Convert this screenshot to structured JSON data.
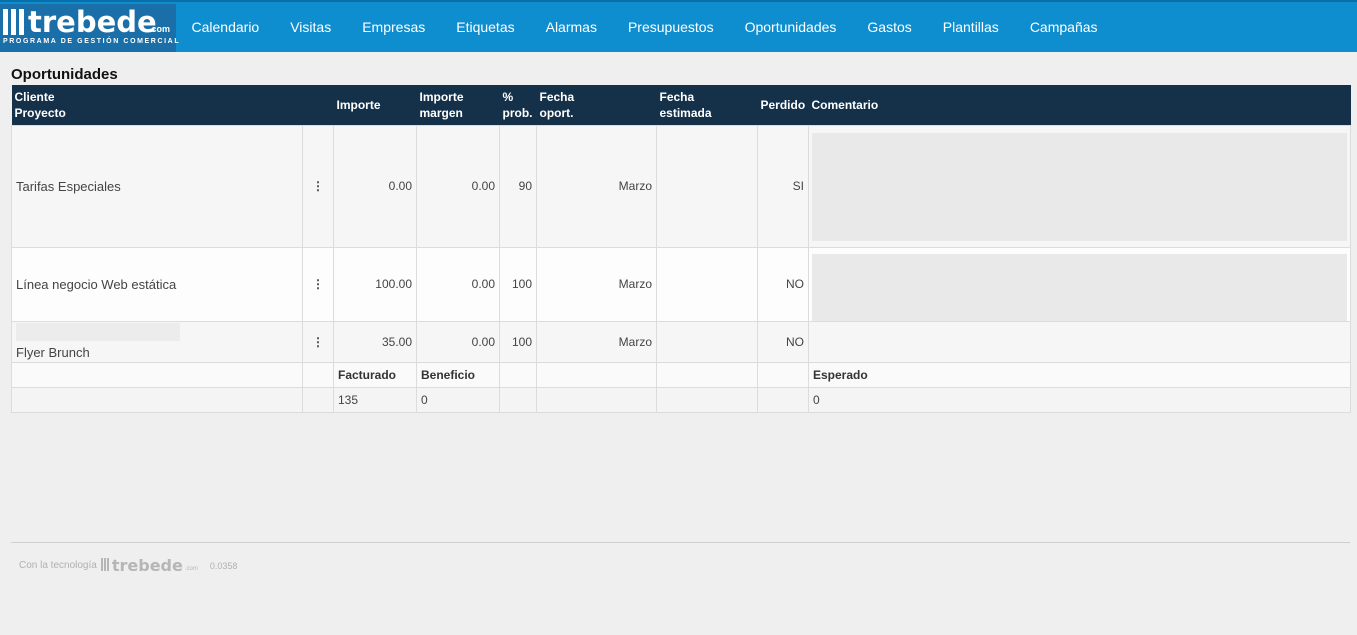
{
  "brand": {
    "name": "trebede",
    "suffix": ".com",
    "tagline": "PROGRAMA DE GESTIÓN COMERCIAL"
  },
  "nav": [
    {
      "label": "Calendario"
    },
    {
      "label": "Visitas"
    },
    {
      "label": "Empresas"
    },
    {
      "label": "Etiquetas"
    },
    {
      "label": "Alarmas"
    },
    {
      "label": "Presupuestos"
    },
    {
      "label": "Oportunidades"
    },
    {
      "label": "Gastos"
    },
    {
      "label": "Plantillas"
    },
    {
      "label": "Campañas"
    }
  ],
  "page_title": "Oportunidades",
  "table": {
    "headers": {
      "client": "Cliente",
      "project": "Proyecto",
      "importe": "Importe",
      "importe_margen_1": "Importe",
      "importe_margen_2": "margen",
      "prob_1": "%",
      "prob_2": "prob.",
      "fecha_oport_1": "Fecha",
      "fecha_oport_2": "oport.",
      "fecha_est_1": "Fecha",
      "fecha_est_2": "estimada",
      "perdido": "Perdido",
      "comentario": "Comentario"
    },
    "rows": [
      {
        "project": "Tarifas Especiales",
        "importe": "0.00",
        "margen": "0.00",
        "prob": "90",
        "fecha_oport": "Marzo",
        "fecha_est": "",
        "perdido": "SI",
        "menu_icon": "⋮"
      },
      {
        "project": "Línea negocio Web estática",
        "importe": "100.00",
        "margen": "0.00",
        "prob": "100",
        "fecha_oport": "Marzo",
        "fecha_est": "",
        "perdido": "NO",
        "menu_icon": "⋮"
      },
      {
        "project": "Flyer Brunch",
        "importe": "35.00",
        "margen": "0.00",
        "prob": "100",
        "fecha_oport": "Marzo",
        "fecha_est": "",
        "perdido": "NO",
        "menu_icon": "⋮"
      }
    ],
    "totals": {
      "facturado_label": "Facturado",
      "beneficio_label": "Beneficio",
      "esperado_label": "Esperado",
      "facturado": "135",
      "beneficio": "0",
      "esperado": "0"
    }
  },
  "footer": {
    "prefix": "Con la tecnología",
    "brand": "trebede",
    "suffix": ".com",
    "version": "0.0358"
  }
}
